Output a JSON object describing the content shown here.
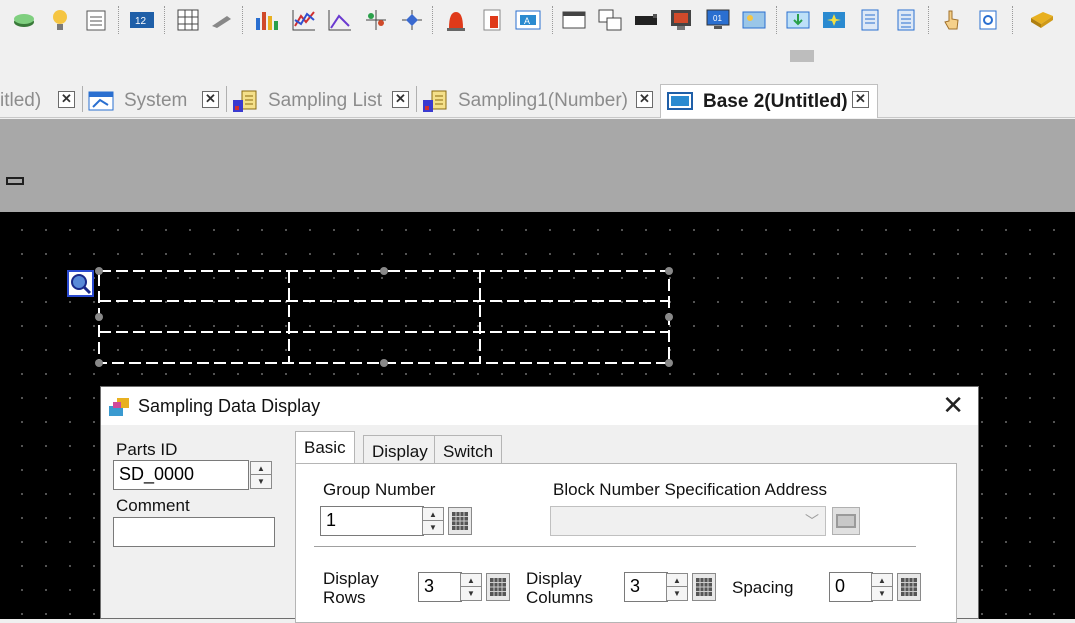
{
  "toolbar": {
    "icons": [
      "lamp-button-icon",
      "bulb-icon",
      "memo-list-icon",
      "numeric-display-icon",
      "table-icon",
      "pen-icon",
      "bar-chart-icon",
      "line-chart-icon",
      "xy-chart-icon",
      "scatter-icon",
      "crosshair-icon",
      "alarm-icon",
      "alarm-history-icon",
      "text-display-icon",
      "window-icon",
      "multi-window-icon",
      "camera-icon",
      "video-icon",
      "monitor-icon",
      "image-display-icon",
      "download-icon",
      "sparkle-icon",
      "list-icon",
      "list2-icon",
      "hand-icon",
      "refresh-icon",
      "folder-icon"
    ]
  },
  "tabs": [
    {
      "label": "itled)"
    },
    {
      "label": "System"
    },
    {
      "label": "Sampling List"
    },
    {
      "label": "Sampling1(Number)"
    },
    {
      "label": "Base 2(Untitled)"
    }
  ],
  "dialog": {
    "title": "Sampling Data Display",
    "parts_id_label": "Parts ID",
    "parts_id_value": "SD_0000",
    "comment_label": "Comment",
    "comment_value": "",
    "tabs": [
      "Basic",
      "Display",
      "Switch"
    ],
    "group_number_label": "Group Number",
    "group_number_value": "1",
    "block_label": "Block Number Specification Address",
    "block_value": "",
    "display_rows_label": "Display Rows",
    "display_rows_value": "3",
    "display_columns_label": "Display Columns",
    "display_columns_value": "3",
    "spacing_label": "Spacing",
    "spacing_value": "0"
  }
}
